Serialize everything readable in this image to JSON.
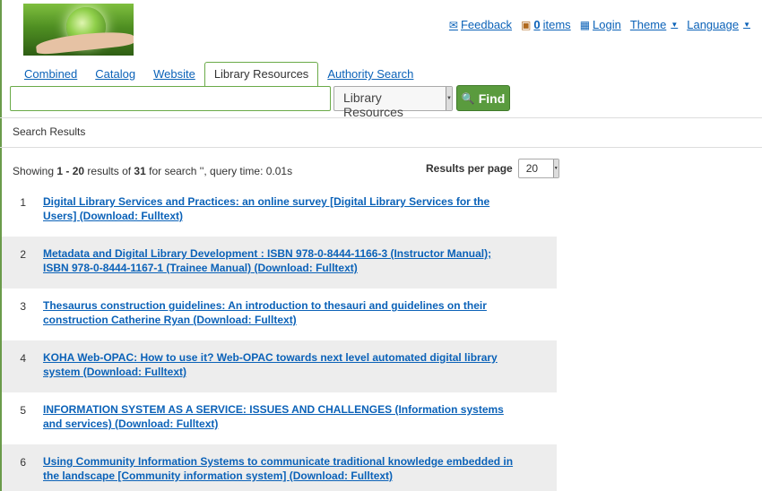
{
  "header": {
    "feedback": "Feedback",
    "cart_count": "0",
    "cart_label": "items",
    "login": "Login",
    "theme": "Theme",
    "language": "Language"
  },
  "icons": {
    "feedback": "envelope-icon",
    "cart": "cart-icon",
    "login": "user-icon",
    "find": "magnifier-icon"
  },
  "colors": {
    "link": "#0b62b8",
    "accent": "#5a9b3e",
    "row_alt": "#ededed"
  },
  "tabs": [
    {
      "label": "Combined"
    },
    {
      "label": "Catalog"
    },
    {
      "label": "Website"
    },
    {
      "label": "Library Resources",
      "active": true
    },
    {
      "label": "Authority Search"
    }
  ],
  "search": {
    "value": "",
    "scope": "Library Resources",
    "find_label": "Find"
  },
  "breadcrumb": "Search Results",
  "summary": {
    "prefix": "Showing ",
    "range": "1 - 20",
    "mid": " results of ",
    "total": "31",
    "suffix": " for search '', query time: 0.01s"
  },
  "results_per_page": {
    "label": "Results per page",
    "value": "20"
  },
  "results": [
    {
      "num": "1",
      "title": "Digital Library Services and Practices: an online survey [Digital Library Services for the Users] (Download: Fulltext)"
    },
    {
      "num": "2",
      "title": "Metadata and Digital Library Development : ISBN 978-0-8444-1166-3 (Instructor Manual); ISBN 978-0-8444-1167-1 (Trainee Manual) (Download: Fulltext)"
    },
    {
      "num": "3",
      "title": "Thesaurus construction guidelines: An introduction to thesauri and guidelines on their construction Catherine Ryan (Download: Fulltext)"
    },
    {
      "num": "4",
      "title": "KOHA Web-OPAC: How to use it? Web-OPAC towards next level automated digital library system (Download: Fulltext)"
    },
    {
      "num": "5",
      "title": "INFORMATION SYSTEM AS A SERVICE: ISSUES AND CHALLENGES (Information systems and services) (Download: Fulltext)"
    },
    {
      "num": "6",
      "title": "Using Community Information Systems to communicate traditional knowledge embedded in the landscape [Community information system] (Download: Fulltext)"
    }
  ]
}
